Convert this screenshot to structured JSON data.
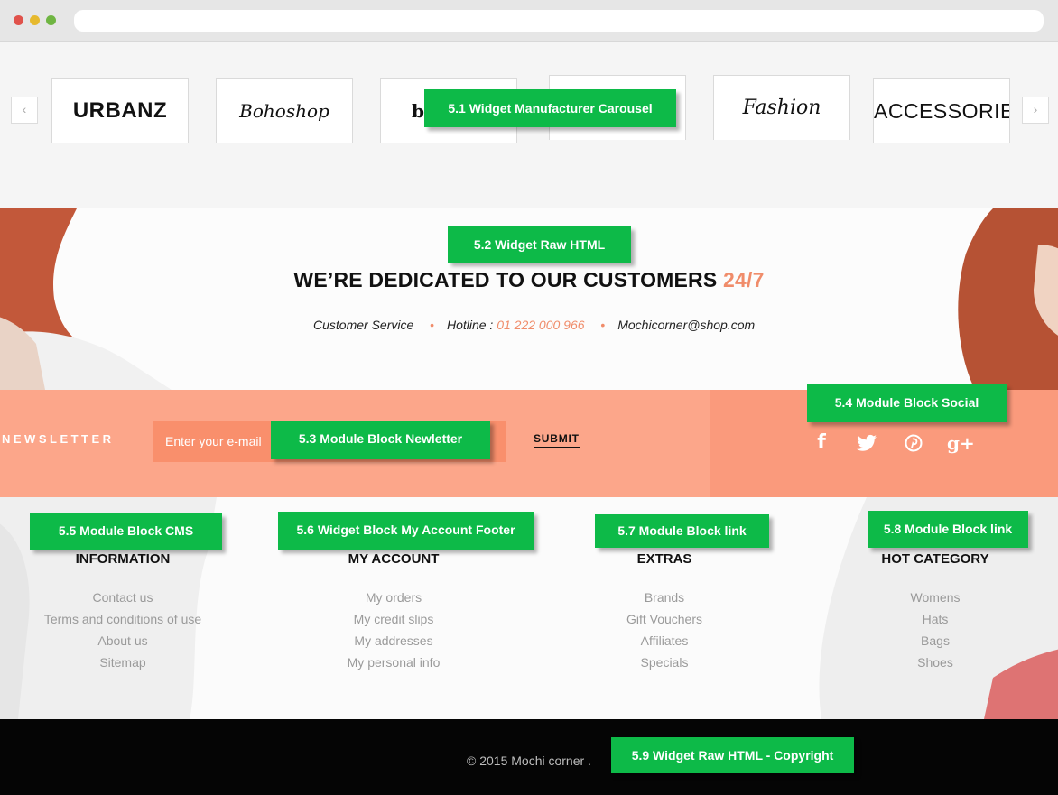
{
  "carousel": {
    "prev_icon": "chevron-left-icon",
    "next_icon": "chevron-right-icon",
    "prev_glyph": "‹",
    "next_glyph": "›",
    "brands": [
      "URBANZ",
      "Bohoshop",
      "bl",
      "",
      "Fashion",
      "ACCESSORIEZ"
    ]
  },
  "labels": {
    "l1": "5.1 Widget Manufacturer Carousel",
    "l2": "5.2 Widget Raw HTML",
    "l3": "5.3 Module Block Newletter",
    "l4": "5.4 Module Block Social",
    "l5": "5.5 Module Block CMS",
    "l6": "5.6 Widget Block My Account Footer",
    "l7": "5.7 Module Block link",
    "l8": "5.8 Module Block link",
    "l9": "5.9 Widget Raw HTML - Copyright"
  },
  "raw_html": {
    "headline": "WE’RE DEDICATED TO OUR CUSTOMERS ",
    "headline_accent": "24/7",
    "customer_service": "Customer Service",
    "separator": "•",
    "hotline_label": "Hotline : ",
    "hotline": "01 222 000 966",
    "email": "Mochicorner@shop.com"
  },
  "newsletter": {
    "title": "NEWSLETTER",
    "placeholder": "Enter your e-mail",
    "submit": "SUBMIT"
  },
  "social": {
    "icons": [
      "facebook-icon",
      "twitter-icon",
      "pinterest-icon",
      "google-plus-icon"
    ],
    "facebook_glyph": "f",
    "google_plus_glyph": "g+"
  },
  "footer": {
    "information": {
      "title": "INFORMATION",
      "links": [
        "Contact us",
        "Terms and conditions of use",
        "About us",
        "Sitemap"
      ]
    },
    "my_account": {
      "title": "MY ACCOUNT",
      "links": [
        "My orders",
        "My credit slips",
        "My addresses",
        "My personal info"
      ]
    },
    "extras": {
      "title": "EXTRAS",
      "links": [
        "Brands",
        "Gift Vouchers",
        "Affiliates",
        "Specials"
      ]
    },
    "hot_category": {
      "title": "HOT CATEGORY",
      "links": [
        "Womens",
        "Hats",
        "Bags",
        "Shoes"
      ]
    }
  },
  "copyright": "© 2015 Mochi corner .",
  "colors": {
    "accent": "#f08c6a",
    "label_green": "#0dba48",
    "newsletter_bg": "#fca68a",
    "social_bg": "#fa9a7c"
  }
}
